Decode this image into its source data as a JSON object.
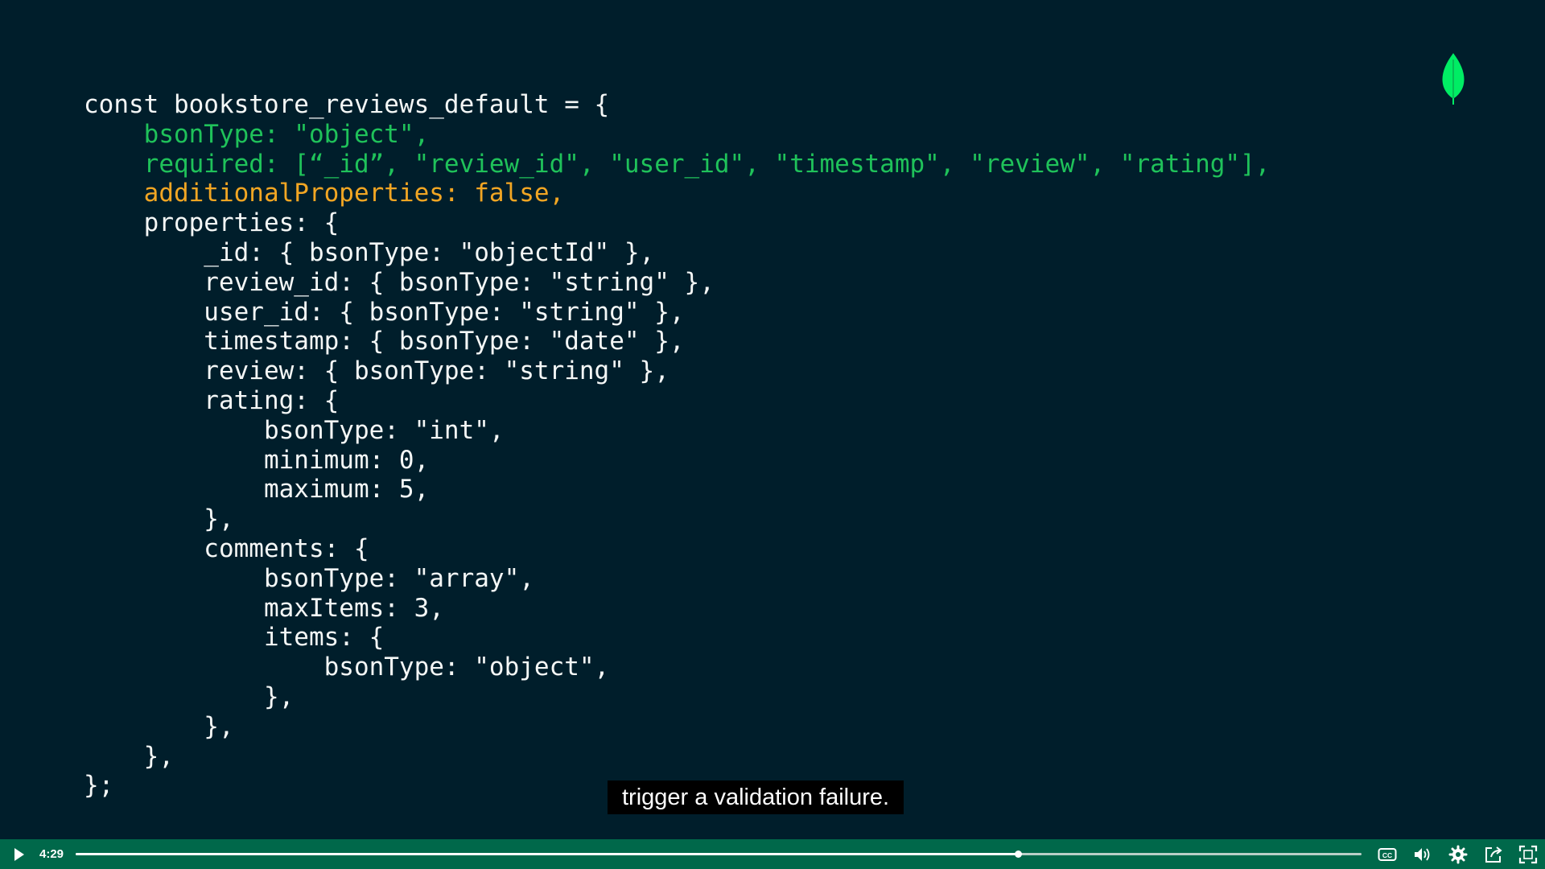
{
  "code": {
    "lines": [
      [
        {
          "t": "const bookstore_reviews_default = {",
          "c": "white"
        }
      ],
      [
        {
          "t": "    ",
          "c": "white"
        },
        {
          "t": "bsonType: \"object\",",
          "c": "green"
        }
      ],
      [
        {
          "t": "    ",
          "c": "white"
        },
        {
          "t": "required: [“_id”, \"review_id\", \"user_id\", \"timestamp\", \"review\", \"rating\"],",
          "c": "green"
        }
      ],
      [
        {
          "t": "    ",
          "c": "white"
        },
        {
          "t": "additionalProperties: false,",
          "c": "amber"
        }
      ],
      [
        {
          "t": "    properties: {",
          "c": "white"
        }
      ],
      [
        {
          "t": "        _id: { bsonType: \"objectId\" },",
          "c": "white"
        }
      ],
      [
        {
          "t": "        review_id: { bsonType: \"string\" },",
          "c": "white"
        }
      ],
      [
        {
          "t": "        user_id: { bsonType: \"string\" },",
          "c": "white"
        }
      ],
      [
        {
          "t": "        timestamp: { bsonType: \"date\" },",
          "c": "white"
        }
      ],
      [
        {
          "t": "        review: { bsonType: \"string\" },",
          "c": "white"
        }
      ],
      [
        {
          "t": "        rating: {",
          "c": "white"
        }
      ],
      [
        {
          "t": "            bsonType: \"int\",",
          "c": "white"
        }
      ],
      [
        {
          "t": "            minimum: 0,",
          "c": "white"
        }
      ],
      [
        {
          "t": "            maximum: 5,",
          "c": "white"
        }
      ],
      [
        {
          "t": "        },",
          "c": "white"
        }
      ],
      [
        {
          "t": "        comments: {",
          "c": "white"
        }
      ],
      [
        {
          "t": "            bsonType: \"array\",",
          "c": "white"
        }
      ],
      [
        {
          "t": "            maxItems: 3,",
          "c": "white"
        }
      ],
      [
        {
          "t": "            items: {",
          "c": "white"
        }
      ],
      [
        {
          "t": "                bsonType: \"object\",",
          "c": "white"
        }
      ],
      [
        {
          "t": "            },",
          "c": "white"
        }
      ],
      [
        {
          "t": "        },",
          "c": "white"
        }
      ],
      [
        {
          "t": "    },",
          "c": "white"
        }
      ],
      [
        {
          "t": "};",
          "c": "white"
        }
      ]
    ]
  },
  "logo": {
    "icon": "mongodb-leaf-icon"
  },
  "caption": {
    "text": "trigger a validation failure."
  },
  "player": {
    "time": "4:29",
    "progress": 0.733,
    "icons": {
      "play": "play-icon",
      "captions": "closed-captions-icon",
      "volume": "volume-icon",
      "settings": "settings-gear-icon",
      "share": "share-icon",
      "fullscreen": "fullscreen-icon"
    }
  },
  "colors": {
    "background": "#001e2b",
    "code_white": "#f4f7f6",
    "code_green": "#1fc25a",
    "code_amber": "#f2a623",
    "player_bar": "#00684a",
    "leaf": "#00ed64"
  }
}
